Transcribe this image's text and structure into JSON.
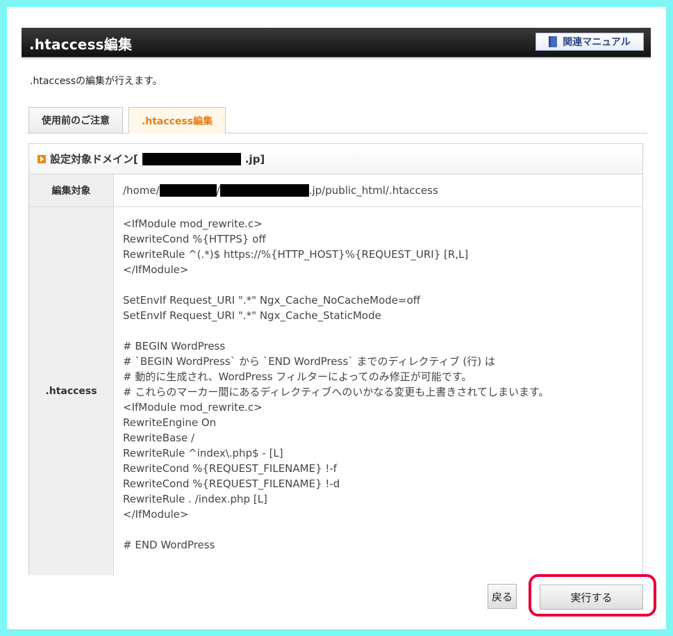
{
  "header": {
    "title": ".htaccess編集",
    "manual_button": "関連マニュアル"
  },
  "description": ".htaccessの編集が行えます。",
  "tabs": [
    {
      "label": "使用前のご注意",
      "active": false
    },
    {
      "label": ".htaccess編集",
      "active": true
    }
  ],
  "panel": {
    "heading_prefix": "設定対象ドメイン[",
    "heading_suffix": ".jp]",
    "target_label": "編集対象",
    "target_path_prefix": "/home/",
    "target_path_sep": "/",
    "target_path_suffix": ".jp/public_html/.htaccess",
    "htaccess_label": ".htaccess",
    "htaccess_content": "<IfModule mod_rewrite.c>\nRewriteCond %{HTTPS} off\nRewriteRule ^(.*)$ https://%{HTTP_HOST}%{REQUEST_URI} [R,L]\n</IfModule>\n\nSetEnvIf Request_URI \".*\" Ngx_Cache_NoCacheMode=off\nSetEnvIf Request_URI \".*\" Ngx_Cache_StaticMode\n\n# BEGIN WordPress\n# `BEGIN WordPress` から `END WordPress` までのディレクティブ (行) は\n# 動的に生成され、WordPress フィルターによってのみ修正が可能です。\n# これらのマーカー間にあるディレクティブへのいかなる変更も上書きされてしまいます。\n<IfModule mod_rewrite.c>\nRewriteEngine On\nRewriteBase /\nRewriteRule ^index\\.php$ - [L]\nRewriteCond %{REQUEST_FILENAME} !-f\nRewriteCond %{REQUEST_FILENAME} !-d\nRewriteRule . /index.php [L]\n</IfModule>\n\n# END WordPress"
  },
  "buttons": {
    "back": "戻る",
    "run": "実行する"
  },
  "colors": {
    "frame": "#7ff6f4",
    "accent_tab": "#e57f12",
    "highlight": "#e4003a"
  },
  "icons": {
    "manual": "book-icon",
    "section": "orange-triangle-icon"
  }
}
